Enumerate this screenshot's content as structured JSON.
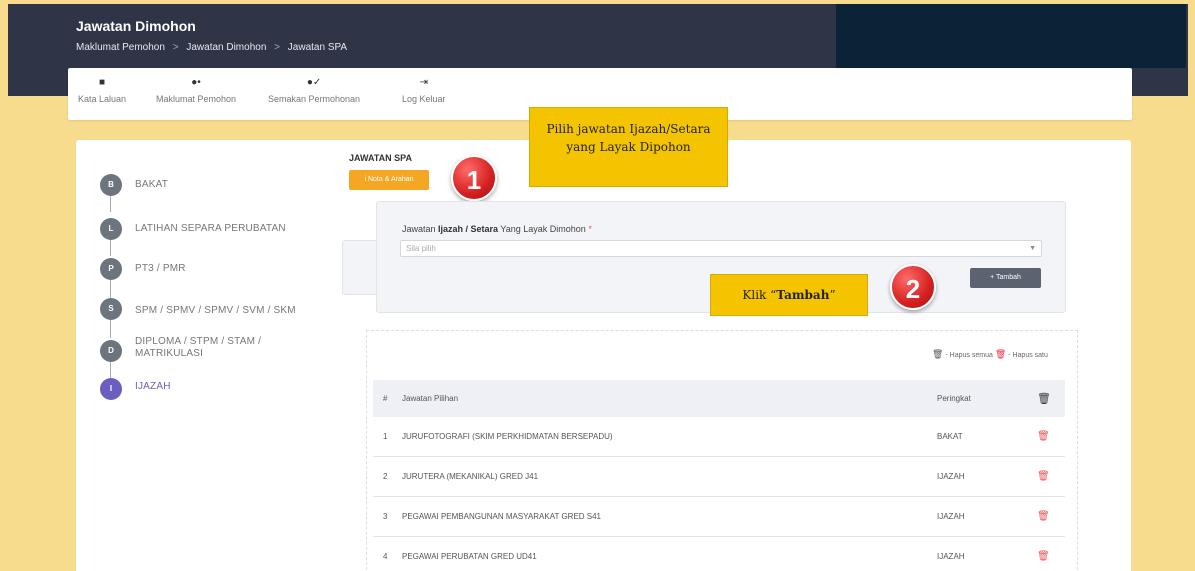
{
  "header": {
    "title": "Jawatan Dimohon",
    "breadcrumb": [
      "Maklumat Pemohon",
      "Jawatan Dimohon",
      "Jawatan SPA"
    ],
    "separator": ">"
  },
  "topnav": {
    "items": [
      {
        "label": "Kata Laluan",
        "icon": "lock-icon",
        "glyph": "🔒"
      },
      {
        "label": "Maklumat Pemohon",
        "icon": "user-gear-icon",
        "glyph": "👤"
      },
      {
        "label": "Semakan Permohonan",
        "icon": "user-check-icon",
        "glyph": "✔"
      },
      {
        "label": "Log Keluar",
        "icon": "logout-icon",
        "glyph": "⇥"
      }
    ]
  },
  "steps": [
    {
      "letter": "B",
      "label": "BAKAT"
    },
    {
      "letter": "L",
      "label": "LATIHAN SEPARA PERUBATAN"
    },
    {
      "letter": "P",
      "label": "PT3 / PMR"
    },
    {
      "letter": "S",
      "label": "SPM / SPMV / SPMV / SVM / SKM"
    },
    {
      "letter": "D",
      "label_line1": "DIPLOMA / STPM / STAM /",
      "label_line2": "MATRIKULASI"
    },
    {
      "letter": "I",
      "label": "IJAZAH",
      "active": true
    }
  ],
  "section": {
    "title": "JAWATAN SPA",
    "nota_button": "i Nota & Arahan"
  },
  "callouts": {
    "badge1": "1",
    "badge2": "2",
    "callout1": "Pilih jawatan Ijazah/Setara yang Layak Dipohon",
    "callout2_prefix": "Klik “",
    "callout2_bold": "Tambah",
    "callout2_suffix": "”"
  },
  "form": {
    "label_prefix": "Jawatan ",
    "label_bold": "Ijazah / Setara",
    "label_suffix": " Yang Layak Dimohon",
    "required_mark": "*",
    "placeholder": "Sila pilih",
    "add_button": "+ Tambah"
  },
  "legend": {
    "delete_all": "- Hapus semua",
    "delete_one": "- Hapus satu"
  },
  "table": {
    "headers": {
      "num": "#",
      "name": "Jawatan Pilihan",
      "rank": "Peringkat",
      "action_icon": "trash-icon"
    },
    "rows": [
      {
        "num": "1",
        "name": "JURUFOTOGRAFI (SKIM PERKHIDMATAN BERSEPADU)",
        "rank": "BAKAT"
      },
      {
        "num": "2",
        "name": "JURUTERA (MEKANIKAL) GRED J41",
        "rank": "IJAZAH"
      },
      {
        "num": "3",
        "name": "PEGAWAI PEMBANGUNAN MASYARAKAT GRED S41",
        "rank": "IJAZAH"
      },
      {
        "num": "4",
        "name": "PEGAWAI PERUBATAN GRED UD41",
        "rank": "IJAZAH"
      }
    ]
  },
  "colors": {
    "header_bg": "#2f3446",
    "page_bg": "#f6dc8c",
    "callout": "#f5c400",
    "badge": "#d62020",
    "active_step": "#6a5fc1",
    "nota_button": "#f5a623"
  }
}
